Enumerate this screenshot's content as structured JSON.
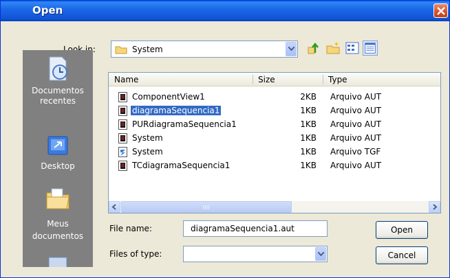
{
  "window": {
    "title": "Open"
  },
  "lookin": {
    "label": "Look in:",
    "value": "System"
  },
  "places": [
    {
      "label": "Documentos recentes",
      "icon": "recent-documents-icon"
    },
    {
      "label": "Desktop",
      "icon": "desktop-icon"
    },
    {
      "label": "Meus documentos",
      "icon": "my-documents-icon"
    }
  ],
  "columns": {
    "name": "Name",
    "size": "Size",
    "type": "Type"
  },
  "files": [
    {
      "name": "ComponentView1",
      "size": "2KB",
      "type": "Arquivo AUT"
    },
    {
      "name": "diagramaSequencia1",
      "size": "1KB",
      "type": "Arquivo AUT",
      "selected": true
    },
    {
      "name": "PURdiagramaSequencia1",
      "size": "1KB",
      "type": "Arquivo AUT"
    },
    {
      "name": "System",
      "size": "1KB",
      "type": "Arquivo AUT"
    },
    {
      "name": "System",
      "size": "1KB",
      "type": "Arquivo TGF"
    },
    {
      "name": "TCdiagramaSequencia1",
      "size": "1KB",
      "type": "Arquivo AUT"
    }
  ],
  "filename": {
    "label": "File name:",
    "value": "diagramaSequencia1.aut"
  },
  "filetype": {
    "label": "Files of type:",
    "value": ""
  },
  "buttons": {
    "open": "Open",
    "cancel": "Cancel"
  },
  "colors": {
    "title_bar": "#0f55d6",
    "selection": "#316ac5",
    "dialog_bg": "#ece9d8",
    "places_bar": "#808080"
  }
}
